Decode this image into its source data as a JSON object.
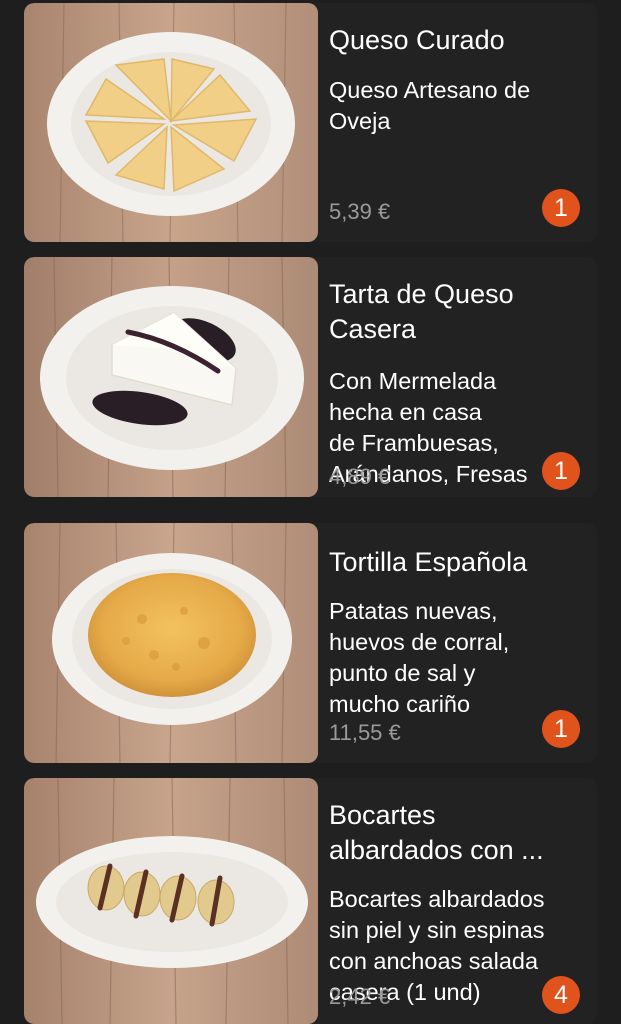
{
  "menu_items": [
    {
      "title": "Queso Curado",
      "description": "Queso Artesano de\nOveja",
      "price": "5,39 €",
      "quantity": "1",
      "photo_icon": "cheese-wedges-plate"
    },
    {
      "title": "Tarta de Queso\nCasera",
      "description": "Con Mermelada\nhecha en casa\nde Frambuesas,\nArándanos, Fresas",
      "price": "4,89 €",
      "quantity": "1",
      "photo_icon": "cheesecake-plate"
    },
    {
      "title": "Tortilla Española",
      "description": "Patatas nuevas,\nhuevos de corral,\npunto de sal y\nmucho cariño",
      "price": "11,55 €",
      "quantity": "1",
      "photo_icon": "spanish-omelette-plate"
    },
    {
      "title": "Bocartes\nalbardados con ...",
      "description": "Bocartes albardados\nsin piel y sin espinas\ncon anchoas salada\ncasera (1 und)",
      "price": "2,42 €",
      "quantity": "4",
      "photo_icon": "anchovies-plate"
    }
  ],
  "colors": {
    "background": "#1e1e1e",
    "card": "#222222",
    "badge": "#e0531c",
    "price": "#9a9a9a"
  }
}
